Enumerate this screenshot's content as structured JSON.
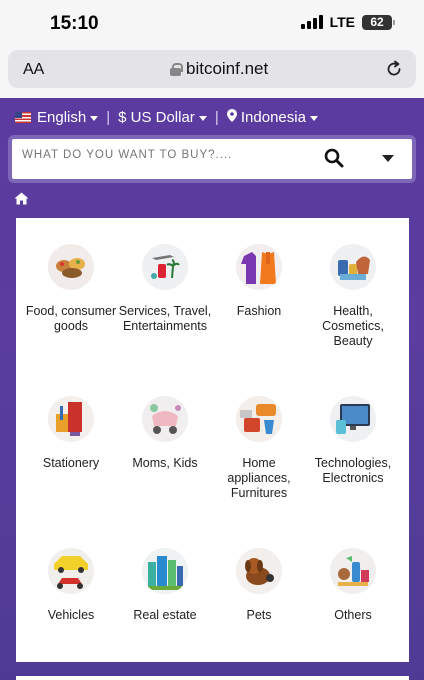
{
  "status_bar": {
    "time": "15:10",
    "network": "LTE",
    "battery": "62"
  },
  "browser": {
    "aa_label": "AA",
    "url": "bitcoinf.net"
  },
  "header": {
    "language": "English",
    "currency": "$ US Dollar",
    "country": "Indonesia",
    "separator": "|"
  },
  "search": {
    "placeholder": "WHAT DO YOU WANT TO BUY?...."
  },
  "categories": [
    {
      "label": "Food, consumer goods",
      "icon": "food-icon"
    },
    {
      "label": "Services, Travel, Entertainments",
      "icon": "travel-icon"
    },
    {
      "label": "Fashion",
      "icon": "fashion-icon"
    },
    {
      "label": "Health, Cosmetics, Beauty",
      "icon": "health-icon"
    },
    {
      "label": "Stationery",
      "icon": "stationery-icon"
    },
    {
      "label": "Moms, Kids",
      "icon": "moms-kids-icon"
    },
    {
      "label": "Home appliances, Furnitures",
      "icon": "home-appliances-icon"
    },
    {
      "label": "Technologies, Electronics",
      "icon": "electronics-icon"
    },
    {
      "label": "Vehicles",
      "icon": "vehicles-icon"
    },
    {
      "label": "Real estate",
      "icon": "real-estate-icon"
    },
    {
      "label": "Pets",
      "icon": "pets-icon"
    },
    {
      "label": "Others",
      "icon": "others-icon"
    }
  ],
  "colors": {
    "header_bg": "#5b3ba0",
    "panel_bg": "#ffffff"
  }
}
